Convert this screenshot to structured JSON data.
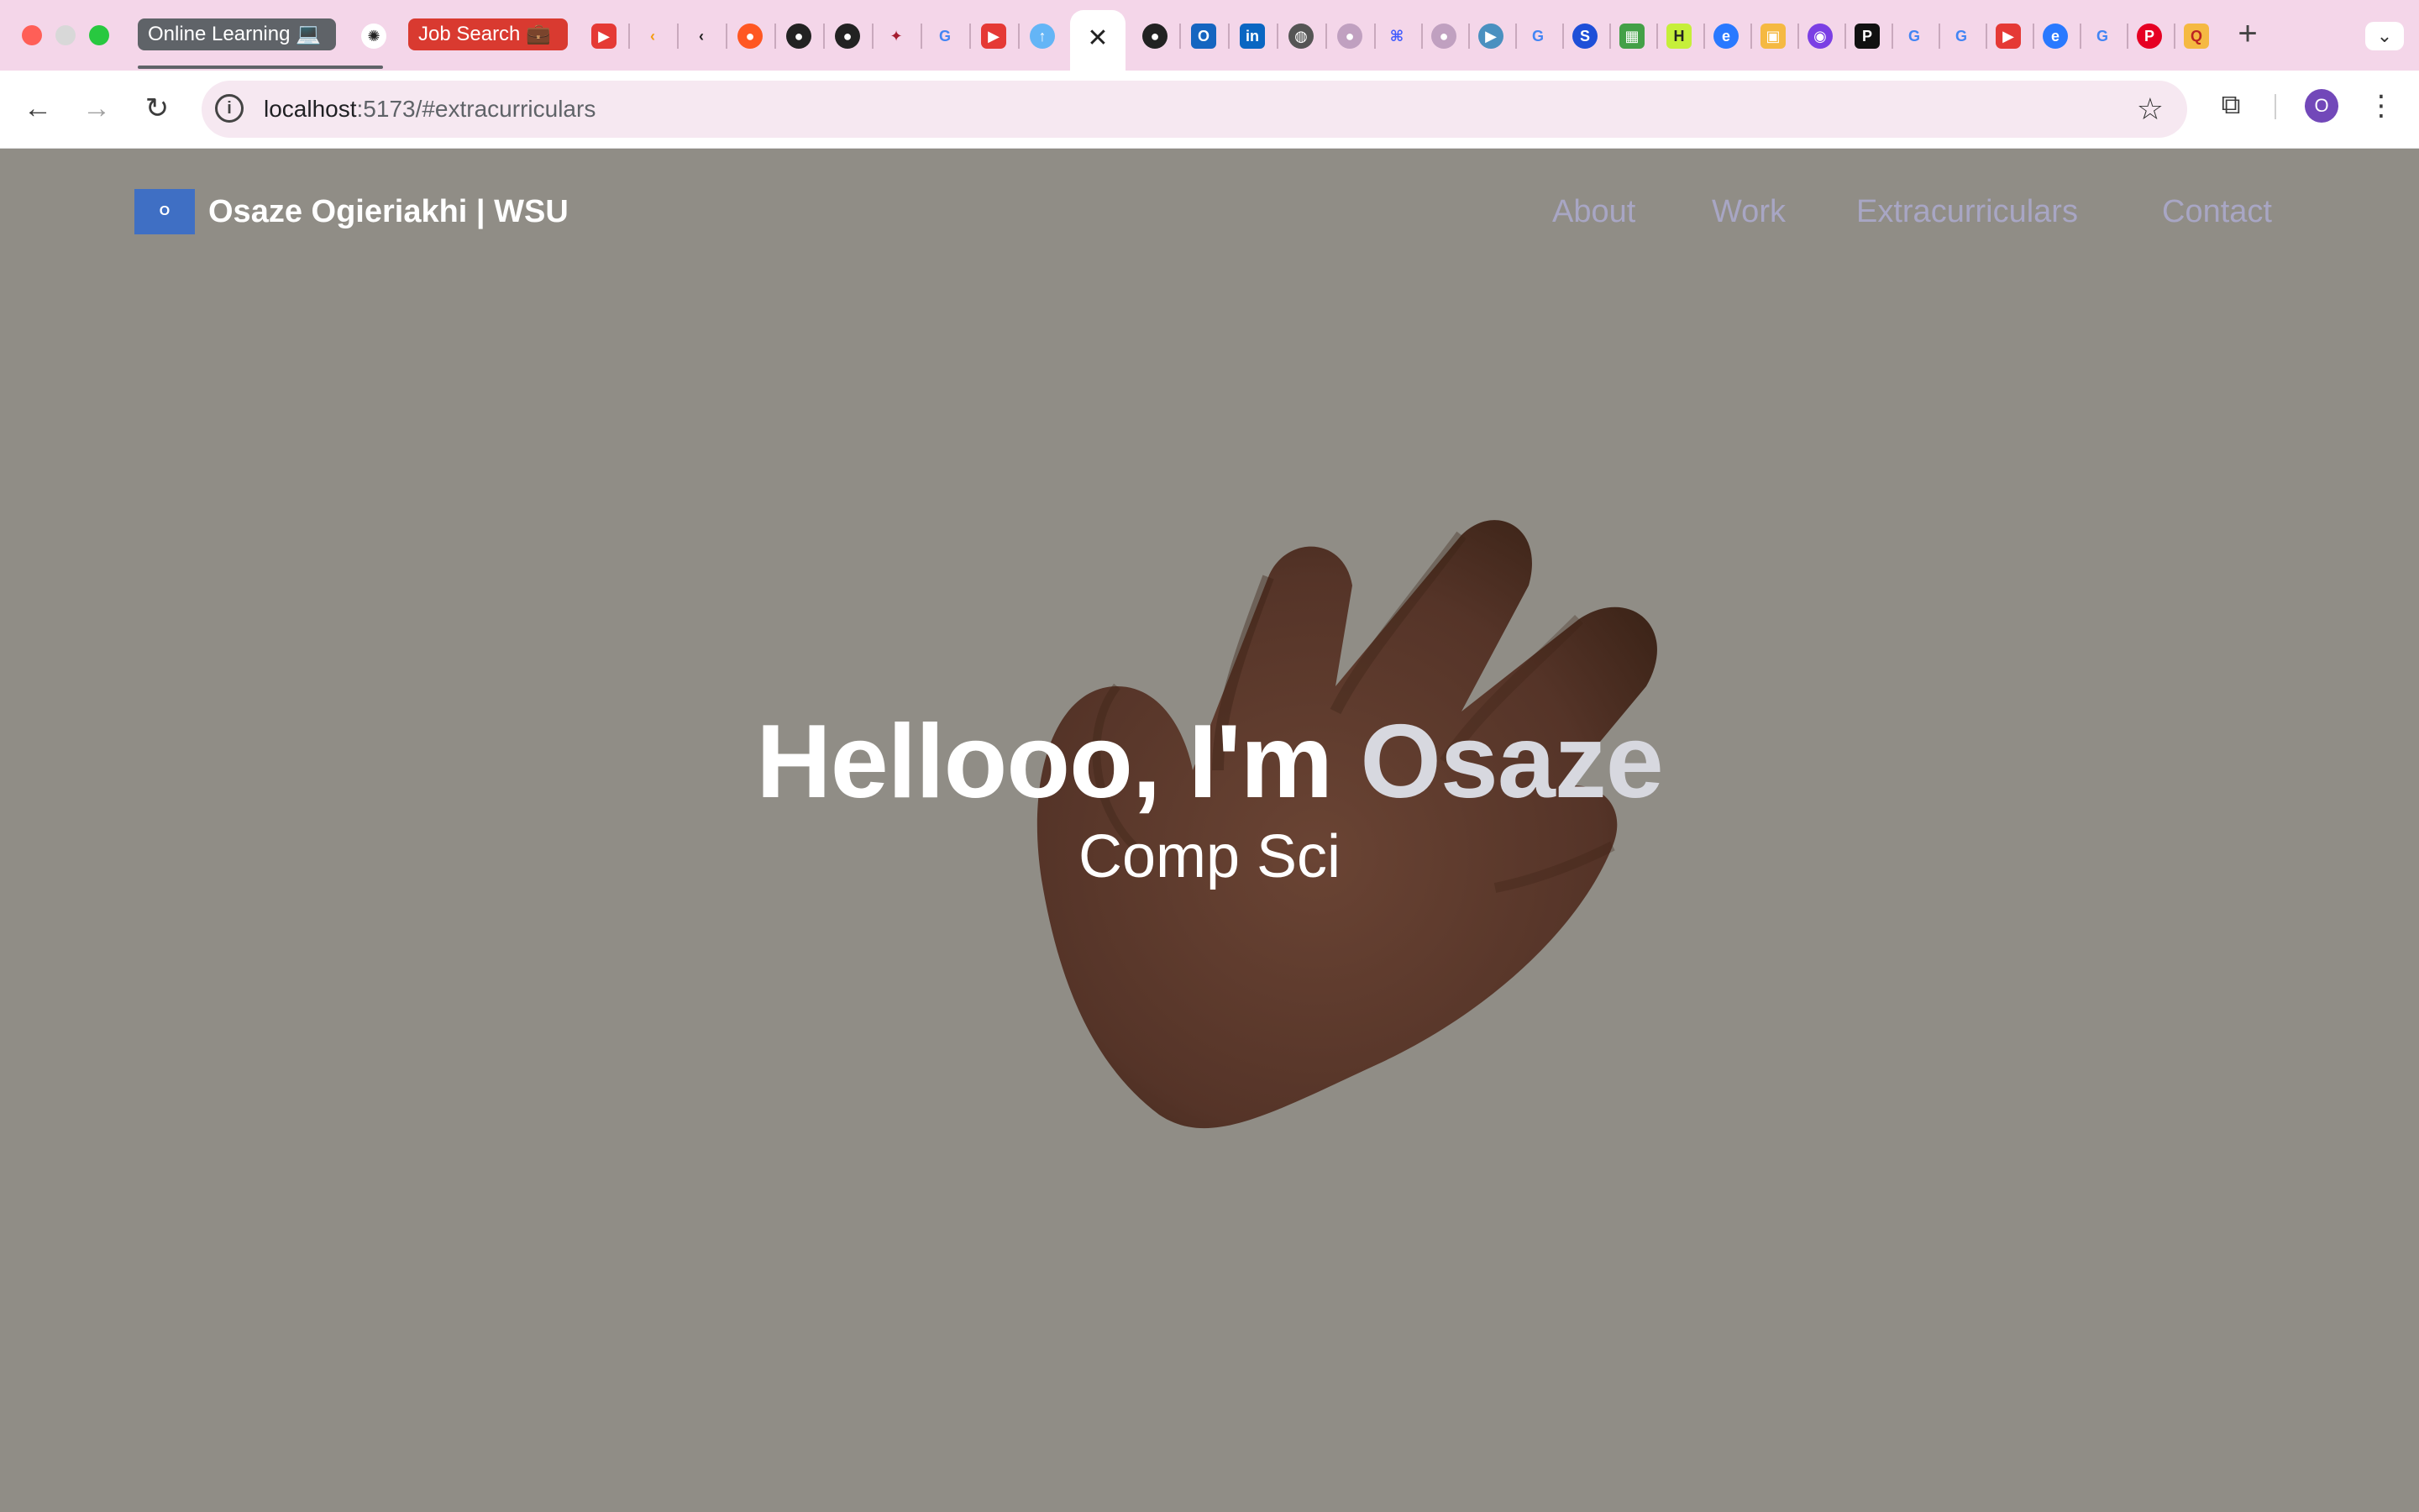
{
  "browser": {
    "tab_groups": [
      {
        "label": "Online Learning 💻"
      },
      {
        "label": "Job Search 💼"
      }
    ],
    "address_bar": {
      "host": "localhost",
      "path": ":5173/#extracurriculars"
    },
    "profile_initial": "O",
    "colors": {
      "tabstrip": "#f4d6e9",
      "omnibox": "#f6e8f1",
      "online_group": "#5f6368",
      "job_group": "#d93a30",
      "profile": "#7248b9"
    },
    "tab_icons": [
      "chatgpt-icon",
      "youtube-icon",
      "leetcode-icon",
      "leetcode-icon",
      "reddit-icon",
      "github-icon",
      "github-icon",
      "wsu-icon",
      "google-icon",
      "youtube-icon",
      "upload-icon",
      "close-icon",
      "github-icon",
      "outlook-icon",
      "linkedin-icon",
      "globe-icon",
      "github-icon",
      "app-icon",
      "github-icon",
      "play-icon",
      "google-icon",
      "app-icon",
      "app-icon",
      "hackathon-icon",
      "edge-icon",
      "app-icon",
      "app-icon",
      "app-icon",
      "google-icon",
      "google-icon",
      "youtube-icon",
      "edge-icon",
      "google-icon",
      "pinterest-icon",
      "search-icon"
    ]
  },
  "site": {
    "logo_text": "O",
    "brand": "Osaze Ogieriakhi  | WSU",
    "nav": {
      "about": "About",
      "work": "Work",
      "extracurriculars": "Extracurriculars",
      "contact": "Contact"
    },
    "hero": {
      "title_prefix": "Hellooo, I'm ",
      "title_name": "Osaze",
      "subtitle": "Comp Sci"
    },
    "colors": {
      "background": "#908d86",
      "nav_link": "#a8a6c4",
      "logo_bg": "#3f6fc4"
    }
  }
}
